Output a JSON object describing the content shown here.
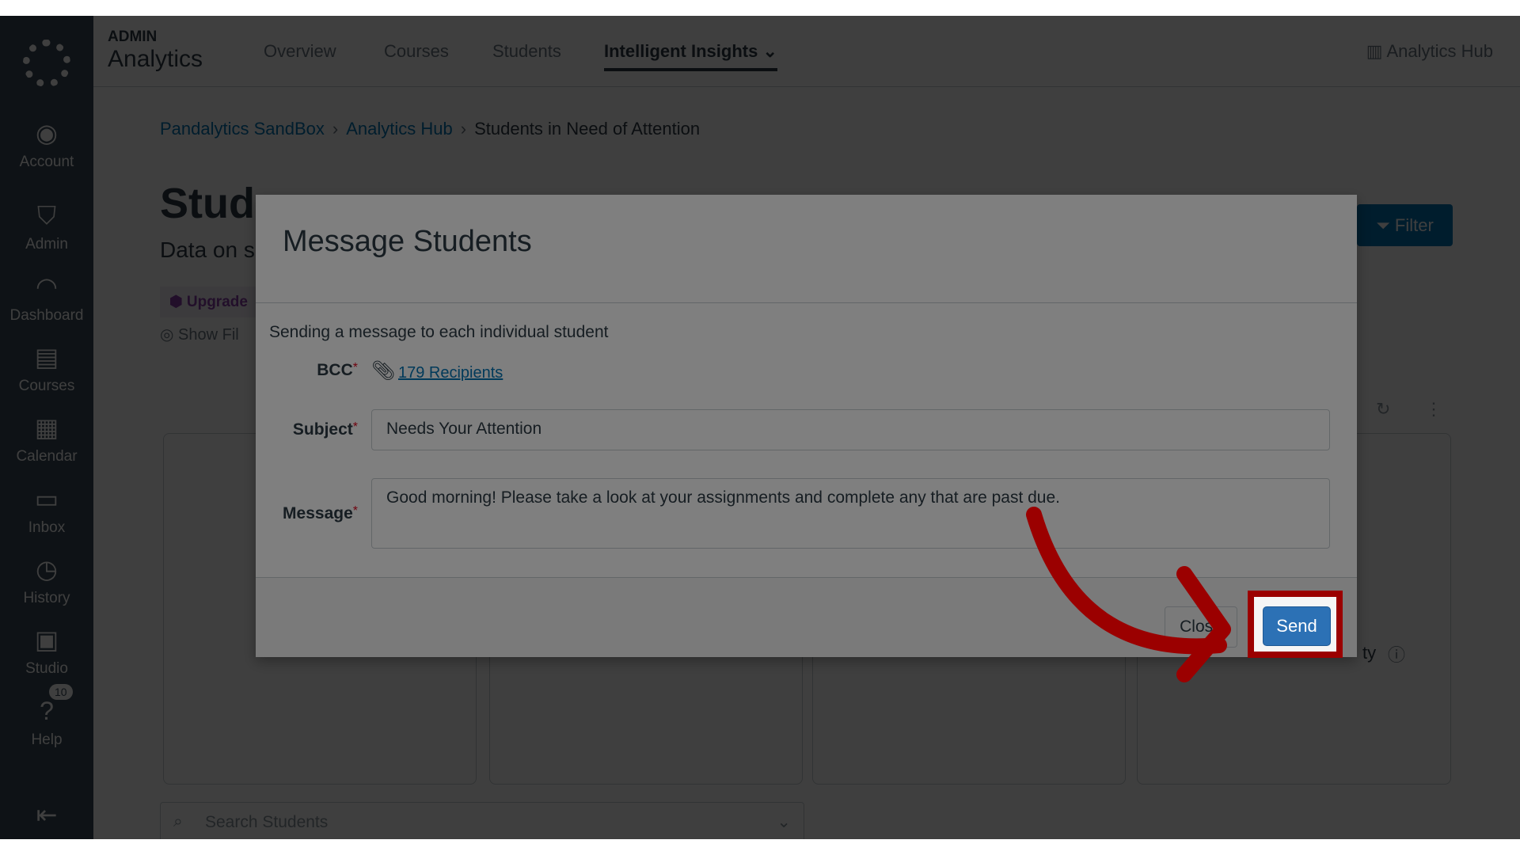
{
  "sidebar": {
    "items": [
      {
        "label": "Account",
        "icon": "user-avatar-icon"
      },
      {
        "label": "Admin",
        "icon": "shield-key-icon"
      },
      {
        "label": "Dashboard",
        "icon": "speedometer-icon"
      },
      {
        "label": "Courses",
        "icon": "book-icon"
      },
      {
        "label": "Calendar",
        "icon": "calendar-icon"
      },
      {
        "label": "Inbox",
        "icon": "inbox-icon"
      },
      {
        "label": "History",
        "icon": "clock-icon"
      },
      {
        "label": "Studio",
        "icon": "studio-icon"
      },
      {
        "label": "Help",
        "icon": "help-icon",
        "badge": "10"
      }
    ],
    "collapse_icon": "collapse-left-icon"
  },
  "header": {
    "small": "ADMIN",
    "title": "Analytics",
    "tabs": [
      {
        "label": "Overview"
      },
      {
        "label": "Courses"
      },
      {
        "label": "Students"
      },
      {
        "label": "Intelligent Insights",
        "active": true
      }
    ],
    "hub": "Analytics Hub"
  },
  "breadcrumb": [
    "Pandalytics SandBox",
    "Analytics Hub",
    "Students in Need of Attention"
  ],
  "page": {
    "title": "Stude",
    "subtitle": "Data on s",
    "upgrade": "Upgrade",
    "show_filters": "Show Fil",
    "filter": "Filter",
    "card_tail": "ty",
    "search_placeholder": "Search Students"
  },
  "modal": {
    "title": "Message Students",
    "intro": "Sending a message to each individual student",
    "bcc_label": "BCC",
    "recipients": "179 Recipients",
    "subject_label": "Subject",
    "subject_value": "Needs Your Attention",
    "message_label": "Message",
    "message_value": "Good morning! Please take a look at your assignments and complete any that are past due.",
    "close": "Close",
    "send": "Send"
  },
  "colors": {
    "accent": "#2c71b5",
    "highlight": "#9b0000",
    "sidebar": "#394b58"
  }
}
